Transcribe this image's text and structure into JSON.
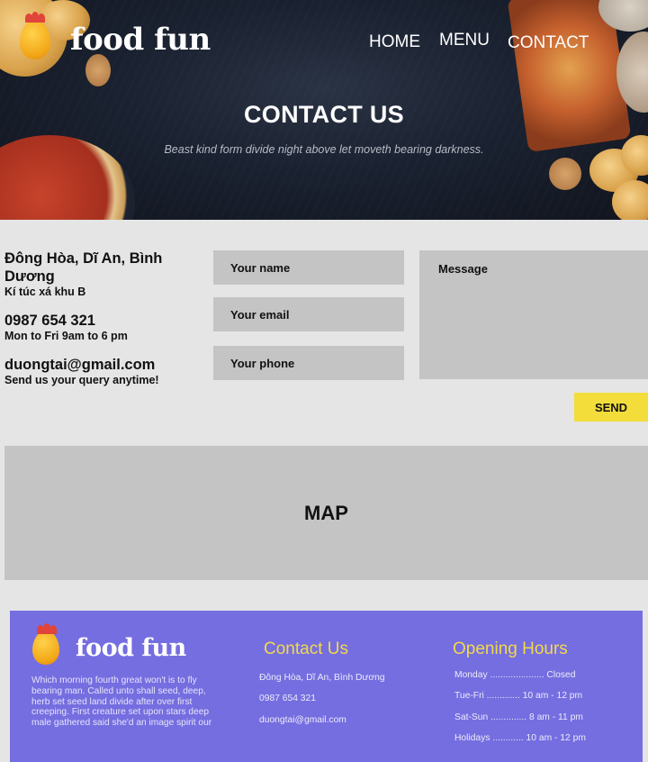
{
  "brand": {
    "name": "food fun"
  },
  "nav": {
    "home": "HOME",
    "menu": "MENU",
    "contact": "CONTACT"
  },
  "hero": {
    "title": "CONTACT US",
    "subtitle": "Beast kind form divide night above let moveth bearing darkness."
  },
  "contact_info": {
    "address": "Đông Hòa, Dĩ An, Bình Dương",
    "address_sub": "Kí túc xá khu B",
    "phone": "0987 654 321",
    "phone_sub": "Mon to Fri 9am to 6 pm",
    "email": "duongtai@gmail.com",
    "email_sub": "Send us your query anytime!"
  },
  "form": {
    "name_placeholder": "Your name",
    "email_placeholder": "Your email",
    "phone_placeholder": "Your phone",
    "message_placeholder": "Message",
    "send_label": "SEND"
  },
  "map": {
    "label": "MAP"
  },
  "footer": {
    "brand": "food fun",
    "description": "Which morning fourth great won't is to fly bearing man. Called unto shall seed, deep, herb set seed land divide after over first creeping. First creature set upon stars deep male gathered said she'd an image spirit our",
    "contact_title": "Contact Us",
    "contact_address": "Đông Hòa, Dĩ An, Bình Dương",
    "contact_phone": "0987 654 321",
    "contact_email": "duongtai@gmail.com",
    "hours_title": "Opening Hours",
    "hours": [
      "Monday ..................... Closed",
      "Tue-Fri ............. 10 am - 12 pm",
      "Sat-Sun .............. 8 am - 11 pm",
      "Holidays ............ 10 am - 12 pm"
    ]
  },
  "colors": {
    "send_button": "#f2dd3b",
    "footer_bg": "#756ee0",
    "footer_title": "#f2d94a",
    "field_bg": "#c4c4c4"
  },
  "icons": [
    "chicken-egg-logo-icon"
  ]
}
